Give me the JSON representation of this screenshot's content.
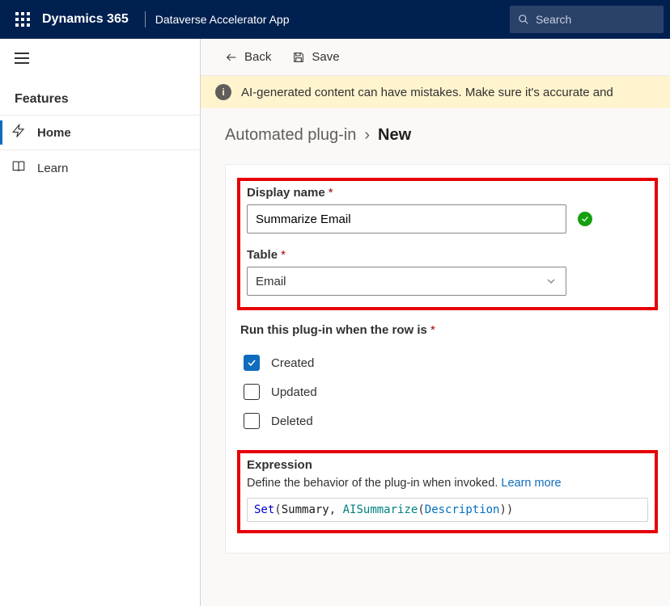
{
  "header": {
    "brand": "Dynamics 365",
    "appName": "Dataverse Accelerator App",
    "searchPlaceholder": "Search"
  },
  "sidebar": {
    "groupHeader": "Features",
    "items": [
      {
        "label": "Home",
        "selected": true
      },
      {
        "label": "Learn",
        "selected": false
      }
    ]
  },
  "commands": {
    "back": "Back",
    "save": "Save"
  },
  "infoBar": {
    "text": "AI-generated content can have mistakes. Make sure it's accurate and"
  },
  "breadcrumb": {
    "parent": "Automated plug-in",
    "current": "New"
  },
  "form": {
    "displayNameLabel": "Display name",
    "displayNameValue": "Summarize Email",
    "tableLabel": "Table",
    "tableValue": "Email",
    "triggerLabel": "Run this plug-in when the row is",
    "triggers": {
      "created": {
        "label": "Created",
        "checked": true
      },
      "updated": {
        "label": "Updated",
        "checked": false
      },
      "deleted": {
        "label": "Deleted",
        "checked": false
      }
    },
    "expression": {
      "label": "Expression",
      "desc": "Define the behavior of the plug-in when invoked.",
      "learnMore": "Learn more",
      "tokens": {
        "set": "Set",
        "summary": "Summary",
        "aisum": "AISummarize",
        "desc": "Description"
      }
    }
  }
}
